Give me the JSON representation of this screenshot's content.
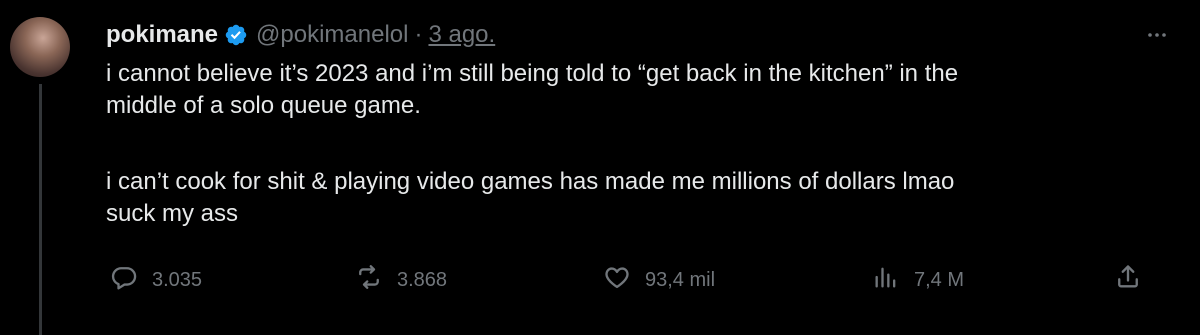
{
  "tweet": {
    "display_name": "pokimane",
    "handle": "@pokimanelol",
    "separator": "·",
    "time": "3 ago.",
    "body": {
      "paragraph_1": "i cannot believe it’s 2023 and i’m still being told to “get back in the kitchen” in the\nmiddle of a solo queue game.",
      "paragraph_2": "i can’t cook for shit & playing video games has made me millions of dollars lmao\nsuck my ass"
    },
    "actions": {
      "replies": "3.035",
      "reposts": "3.868",
      "likes": "93,4 mil",
      "views": "7,4 M"
    }
  },
  "icons": {
    "verified": "verified-badge-icon",
    "more": "more-horizontal-icon",
    "reply": "reply-icon",
    "repost": "repost-icon",
    "like": "heart-icon",
    "views": "views-chart-icon",
    "share": "share-icon"
  },
  "colors": {
    "background": "#000000",
    "text_primary": "#e7e9ea",
    "text_secondary": "#71767b",
    "verified": "#1d9bf0"
  }
}
